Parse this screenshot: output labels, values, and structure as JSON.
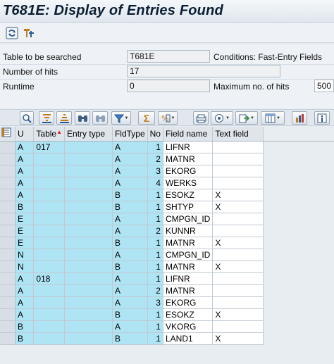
{
  "window": {
    "title": "T681E: Display of Entries Found"
  },
  "app_toolbar": {
    "buttons": [
      {
        "icon": "refresh-icon"
      },
      {
        "icon": "technical-settings-icon"
      }
    ]
  },
  "form": {
    "table_label": "Table to be searched",
    "table_value": "T681E",
    "conditions_label": "Conditions: Fast-Entry Fields",
    "hits_label": "Number of hits",
    "hits_value": "17",
    "runtime_label": "Runtime",
    "runtime_value": "0",
    "max_hits_label": "Maximum no. of hits",
    "max_hits_value": "500"
  },
  "alv_toolbar": {
    "buttons": [
      "details-icon",
      "sort-ascending-icon",
      "sort-descending-icon",
      "find-icon",
      "find-next-icon",
      "filter-icon",
      "sum-icon",
      "subtotals-icon",
      "print-preview-icon",
      "views-icon",
      "export-icon",
      "change-layout-icon",
      "graphic-icon",
      "information-icon"
    ]
  },
  "grid": {
    "select_all_icon": "select-all-icon",
    "columns": [
      "U",
      "Table",
      "Entry type",
      "FldType",
      "No",
      "Field name",
      "Text field"
    ],
    "rows": [
      [
        "A",
        "017",
        "",
        "A",
        "1",
        "LIFNR",
        ""
      ],
      [
        "A",
        "",
        "",
        "A",
        "2",
        "MATNR",
        ""
      ],
      [
        "A",
        "",
        "",
        "A",
        "3",
        "EKORG",
        ""
      ],
      [
        "A",
        "",
        "",
        "A",
        "4",
        "WERKS",
        ""
      ],
      [
        "A",
        "",
        "",
        "B",
        "1",
        "ESOKZ",
        "X"
      ],
      [
        "B",
        "",
        "",
        "B",
        "1",
        "SHTYP",
        "X"
      ],
      [
        "E",
        "",
        "",
        "A",
        "1",
        "CMPGN_ID",
        ""
      ],
      [
        "E",
        "",
        "",
        "A",
        "2",
        "KUNNR",
        ""
      ],
      [
        "E",
        "",
        "",
        "B",
        "1",
        "MATNR",
        "X"
      ],
      [
        "N",
        "",
        "",
        "A",
        "1",
        "CMPGN_ID",
        ""
      ],
      [
        "N",
        "",
        "",
        "B",
        "1",
        "MATNR",
        "X"
      ],
      [
        "A",
        "018",
        "",
        "A",
        "1",
        "LIFNR",
        ""
      ],
      [
        "A",
        "",
        "",
        "A",
        "2",
        "MATNR",
        ""
      ],
      [
        "A",
        "",
        "",
        "A",
        "3",
        "EKORG",
        ""
      ],
      [
        "A",
        "",
        "",
        "B",
        "1",
        "ESOKZ",
        "X"
      ],
      [
        "B",
        "",
        "",
        "A",
        "1",
        "VKORG",
        ""
      ],
      [
        "B",
        "",
        "",
        "B",
        "1",
        "LAND1",
        "X"
      ]
    ]
  },
  "colors": {
    "key_cell": "#aee4f3",
    "title_text": "#0b1e33"
  }
}
